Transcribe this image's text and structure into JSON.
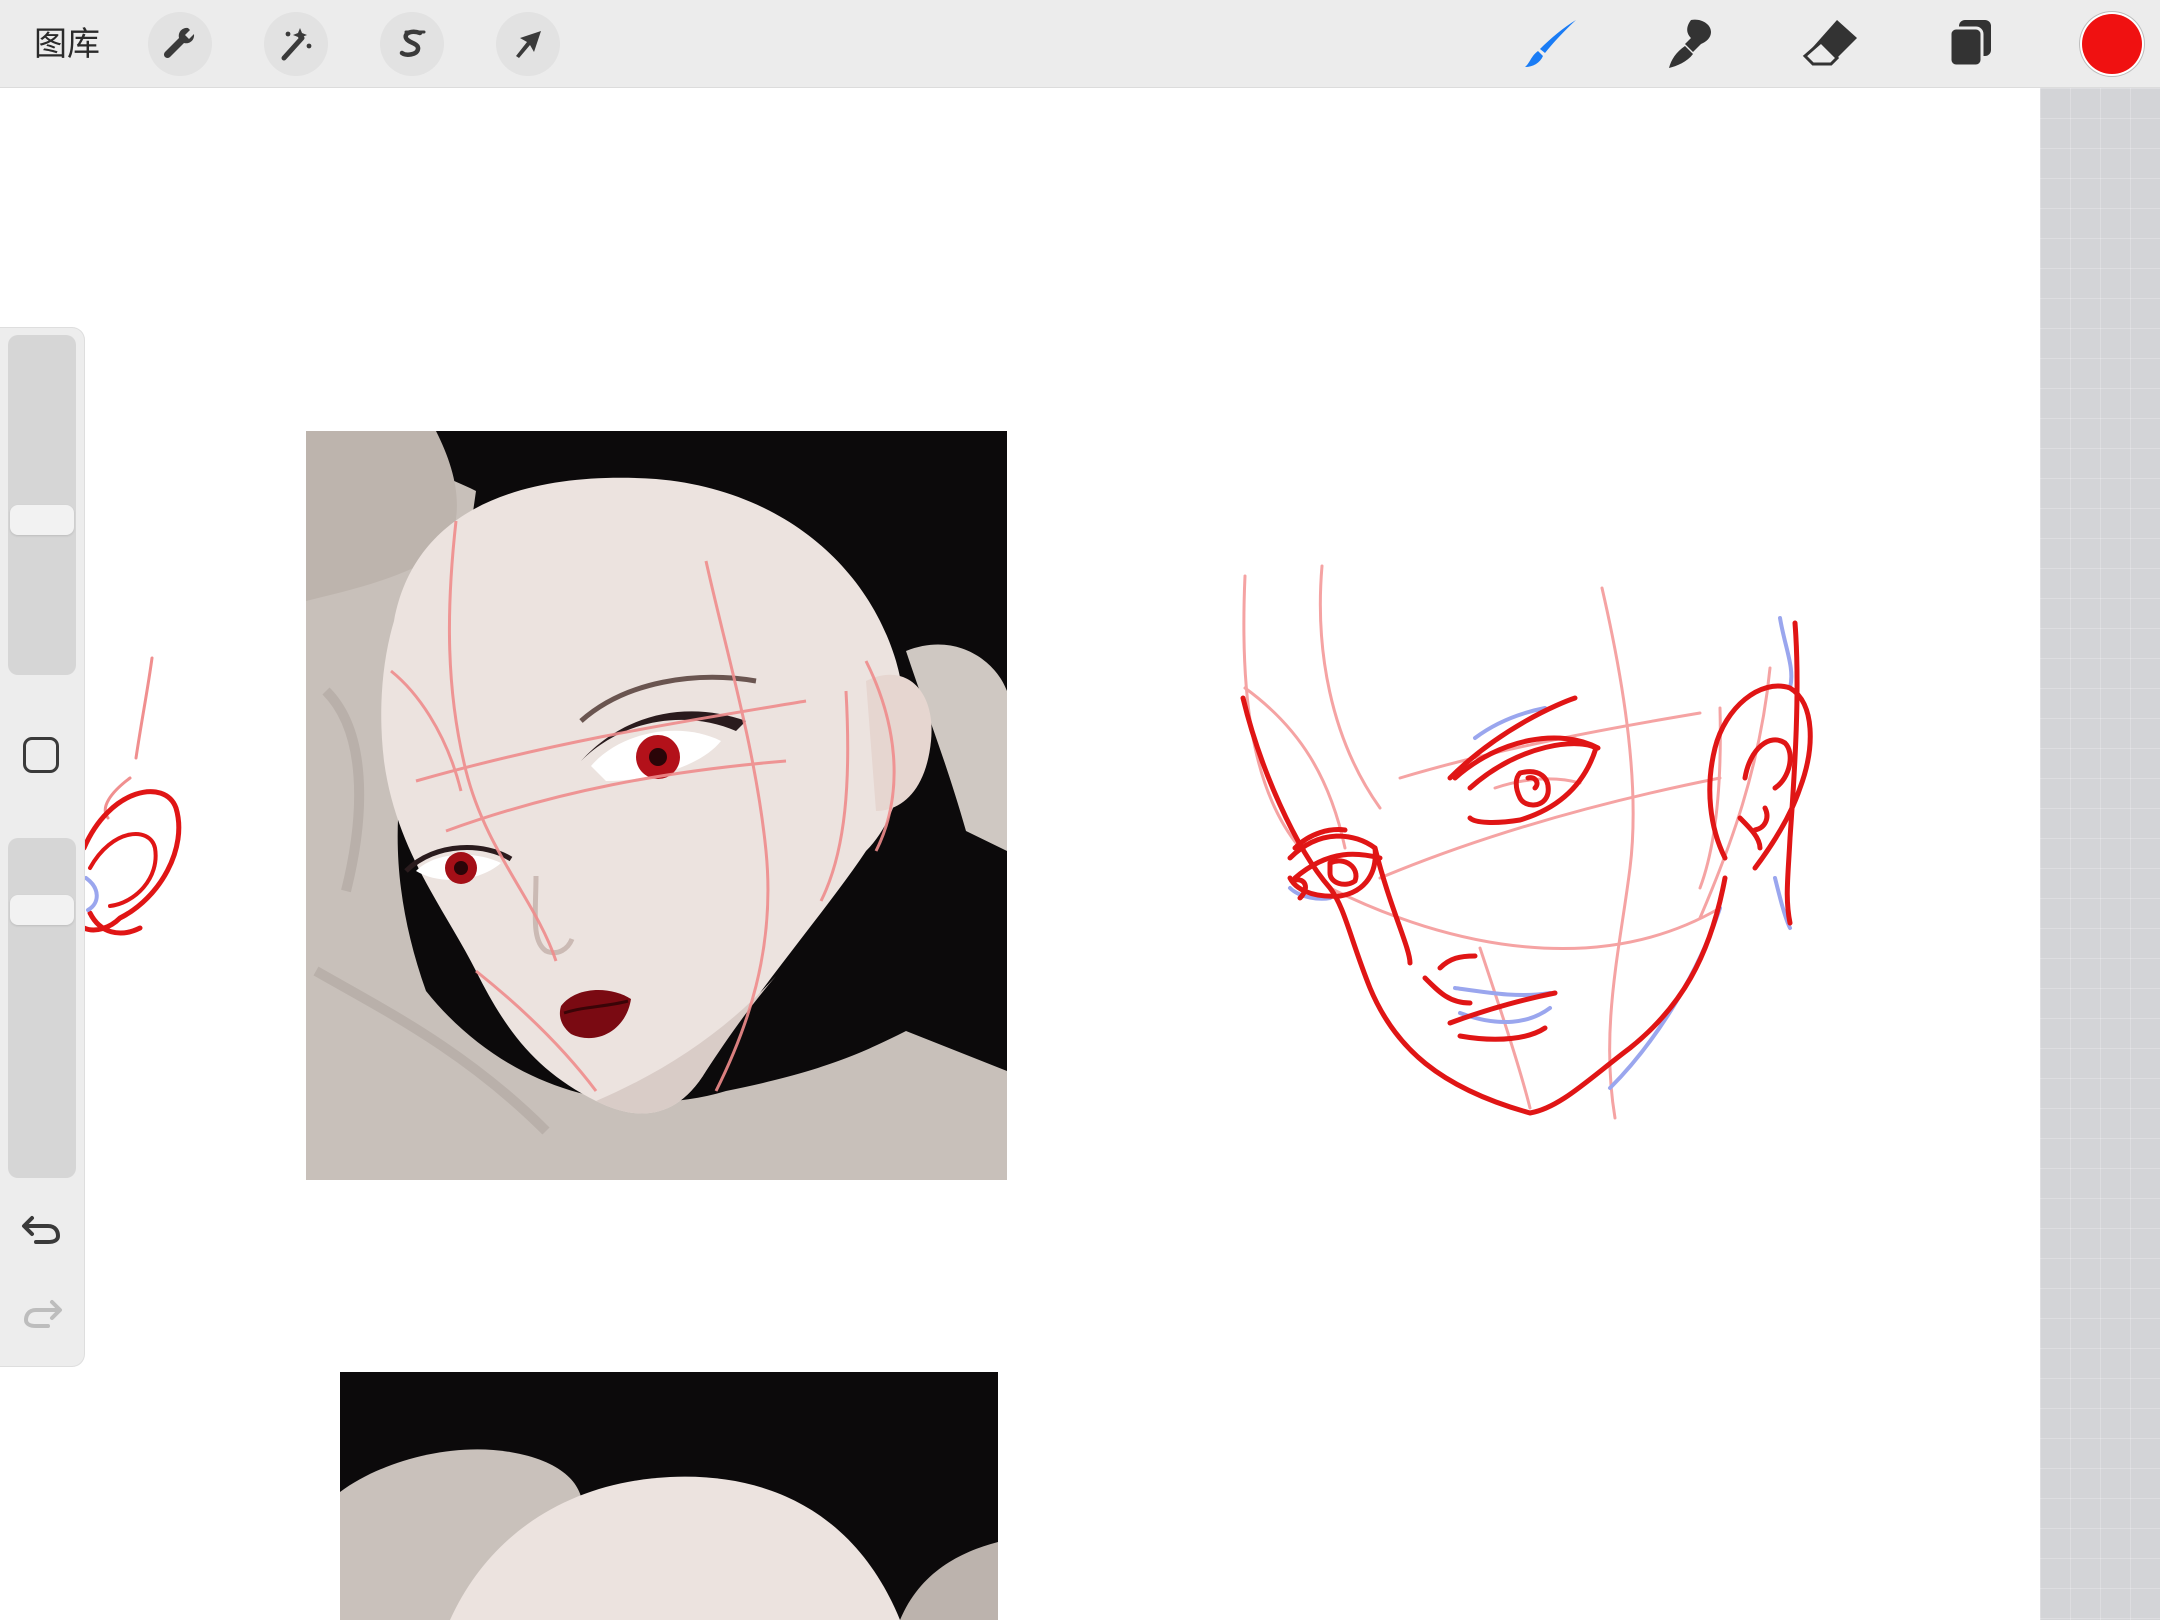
{
  "toolbar": {
    "gallery_label": "图库",
    "left_tools": [
      {
        "name": "actions",
        "icon": "wrench-icon"
      },
      {
        "name": "adjustments",
        "icon": "magic-wand-icon"
      },
      {
        "name": "selection",
        "icon": "selection-s-icon"
      },
      {
        "name": "transform",
        "icon": "arrow-cursor-icon"
      }
    ],
    "right_tools": [
      {
        "name": "brush",
        "icon": "brush-icon",
        "active": true
      },
      {
        "name": "smudge",
        "icon": "smudge-icon"
      },
      {
        "name": "eraser",
        "icon": "eraser-icon"
      },
      {
        "name": "layers",
        "icon": "layers-icon"
      }
    ],
    "current_color": "#f01111",
    "active_tool_color": "#1a7cf5"
  },
  "sidebar": {
    "brush_size_level": 0.45,
    "opacity_level": 0.82,
    "icons": [
      "modify-square-icon",
      "undo-icon",
      "redo-icon"
    ]
  },
  "canvas": {
    "sketch_color": "#e01515",
    "guide_color": "#f08f8f",
    "shade_color": "#9aa6ee",
    "gutter_color": "#d3d4d7"
  }
}
